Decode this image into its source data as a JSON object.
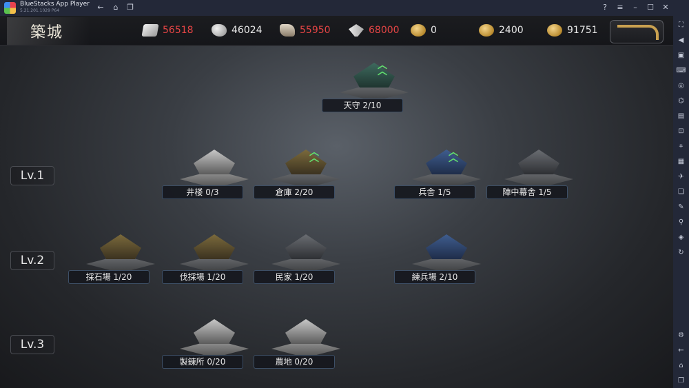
{
  "window": {
    "app_title": "BlueStacks App Player",
    "version": "5.21.201.1029  P64"
  },
  "screen": {
    "title": "築城"
  },
  "resources": [
    {
      "icon": "ore-icon",
      "value": "56518",
      "status": "insufficient"
    },
    {
      "icon": "stone-icon",
      "value": "46024",
      "status": "normal"
    },
    {
      "icon": "wood-icon",
      "value": "55950",
      "status": "insufficient"
    },
    {
      "icon": "food-icon",
      "value": "68000",
      "status": "insufficient"
    },
    {
      "icon": "ticket-icon",
      "value": "0",
      "status": "normal"
    },
    {
      "icon": "gold-coin-icon",
      "value": "2400",
      "status": "normal"
    },
    {
      "icon": "mon-coin-icon",
      "value": "91751",
      "status": "normal"
    }
  ],
  "levels": [
    "Lv.1",
    "Lv.2",
    "Lv.3"
  ],
  "buildings": {
    "tenshu": {
      "label": "天守 2/10",
      "upgradable": true
    },
    "lv1": [
      {
        "label": "井楼 0/3",
        "upgradable": false
      },
      {
        "label": "倉庫 2/20",
        "upgradable": true
      },
      {
        "label": "兵舎 1/5",
        "upgradable": true
      },
      {
        "label": "陣中幕舎 1/5",
        "upgradable": false
      }
    ],
    "lv2": [
      {
        "label": "採石場 1/20",
        "upgradable": false
      },
      {
        "label": "伐採場 1/20",
        "upgradable": false
      },
      {
        "label": "民家 1/20",
        "upgradable": false
      },
      {
        "label": "練兵場 2/10",
        "upgradable": false
      }
    ],
    "lv3": [
      {
        "label": "製錬所 0/20",
        "upgradable": false
      },
      {
        "label": "農地 0/20",
        "upgradable": false
      }
    ]
  },
  "colors": {
    "insufficient": "#e64545",
    "upgrade_arrow": "#63e06f",
    "label_border": "#3d4f66"
  }
}
